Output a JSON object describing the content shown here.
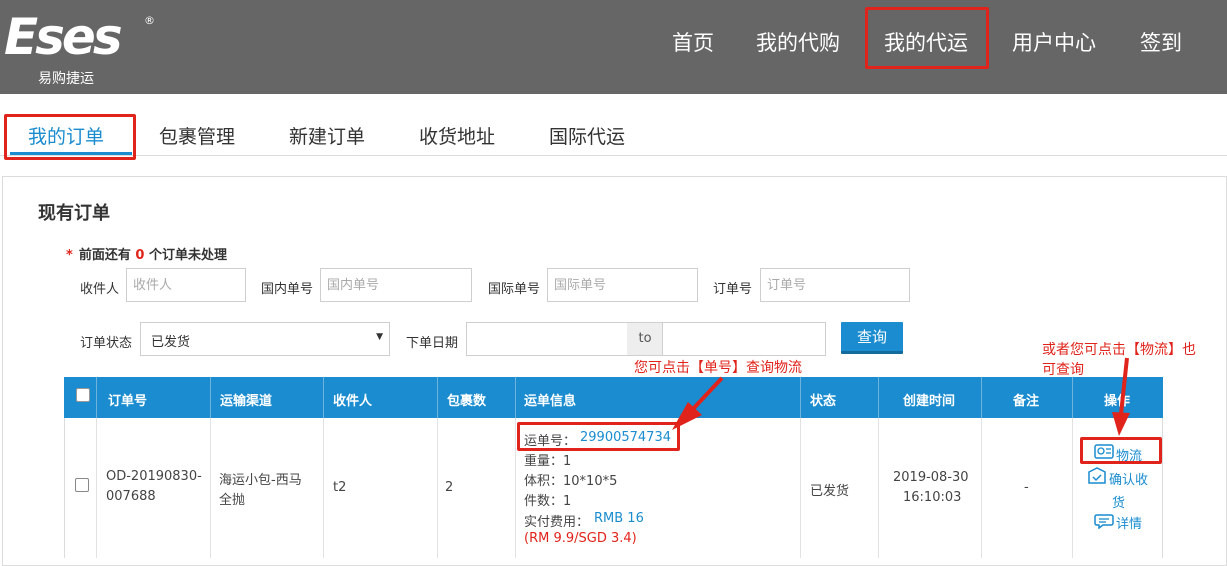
{
  "brand": {
    "logo_word": "Eses",
    "logo_reg": "®",
    "logo_sub": "易购捷运"
  },
  "topnav": [
    "首页",
    "我的代购",
    "我的代运",
    "用户中心",
    "签到"
  ],
  "subtabs": [
    "我的订单",
    "包裹管理",
    "新建订单",
    "收货地址",
    "国际代运"
  ],
  "panel": {
    "title": "现有订单",
    "notice_star": "*",
    "notice_prefix": "前面还有",
    "notice_count": "0",
    "notice_suffix": "个订单未处理"
  },
  "filters": {
    "receiver_label": "收件人",
    "receiver_placeholder": "收件人",
    "domestic_label": "国内单号",
    "domestic_placeholder": "国内单号",
    "intl_label": "国际单号",
    "intl_placeholder": "国际单号",
    "order_label": "订单号",
    "order_placeholder": "订单号",
    "status_label": "订单状态",
    "status_value": "已发货",
    "date_label": "下单日期",
    "date_to": "to",
    "query_button": "查询"
  },
  "annotations": {
    "tracking_hint": "您可点击【单号】查询物流",
    "logistics_hint_line1": "或者您可点击【物流】也",
    "logistics_hint_line2": "可查询"
  },
  "table": {
    "headers": [
      "订单号",
      "运输渠道",
      "收件人",
      "包裹数",
      "运单信息",
      "状态",
      "创建时间",
      "备注",
      "操作"
    ],
    "row": {
      "order_no_line1": "OD-20190830-",
      "order_no_line2": "007688",
      "channel_line1": "海运小包-西马",
      "channel_line2": "全抛",
      "receiver": "t2",
      "packages": "2",
      "waybill_label": "运单号：",
      "waybill_no": "29900574734",
      "weight": "重量：1",
      "volume": "体积：10*10*5",
      "pieces": "件数：1",
      "paid_label": "实付费用：",
      "paid_value": "RMB 16",
      "paid_alt": "(RM 9.9/SGD 3.4)",
      "status": "已发货",
      "created_date": "2019-08-30",
      "created_time": "16:10:03",
      "remark": "-",
      "op_logistics": "物流",
      "op_confirm_line1": "确认收",
      "op_confirm_line2": "货",
      "op_detail": "详情"
    }
  },
  "colors": {
    "header_gray": "#666666",
    "accent_blue": "#1a8ccf",
    "annotation_red": "#e0241b"
  }
}
